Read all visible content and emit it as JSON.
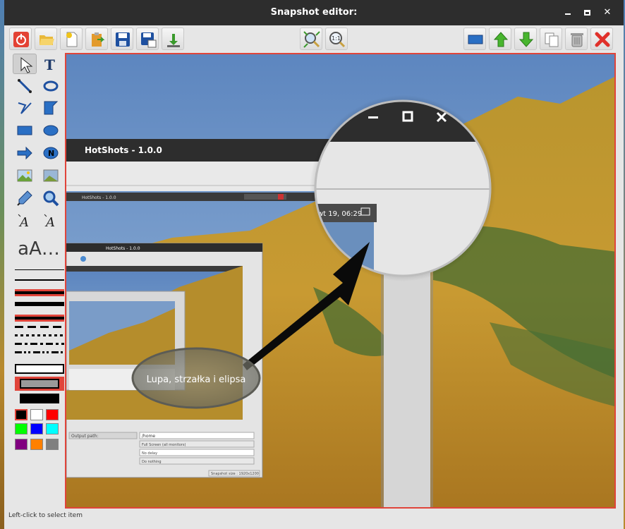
{
  "window": {
    "title": "Snapshot editor:",
    "status": "Left-click to select item"
  },
  "toolbar": {
    "left": [
      "power-icon",
      "folder-open-icon",
      "new-document-icon",
      "clipboard-paste-icon",
      "save-icon",
      "save-as-icon",
      "upload-icon"
    ],
    "center": [
      "fit-zoom-icon",
      "zoom-1to1-icon"
    ],
    "right": [
      "screen-icon",
      "arrow-up-icon",
      "arrow-down-icon",
      "copy-icon",
      "trash-icon",
      "close-icon"
    ]
  },
  "tools": {
    "font_sample": "aA…"
  },
  "colors": {
    "accent_red": "#e0443a",
    "palette": [
      "#000000",
      "#ffffff",
      "#ff0000",
      "#00ff00",
      "#0000ff",
      "#00ffff",
      "#800080",
      "#ff8000",
      "#808080"
    ]
  },
  "screenshot": {
    "inner_title": "HotShots - 1.0.0",
    "inner_title_small": "HotShots - 1.0.0",
    "inner_title_tiny": "HotShots - 1.0.0",
    "clock": "wt 19, 06:29",
    "ellipse_label": "Lupa, strzałka i elipsa",
    "output_path_label": "Output path:",
    "output_path_value": "/home",
    "mode": "Full Screen (all monitors)",
    "delay": "No delay",
    "after": "Do nothing",
    "snapshot_size": "Snapshot size : 1920x1200"
  }
}
